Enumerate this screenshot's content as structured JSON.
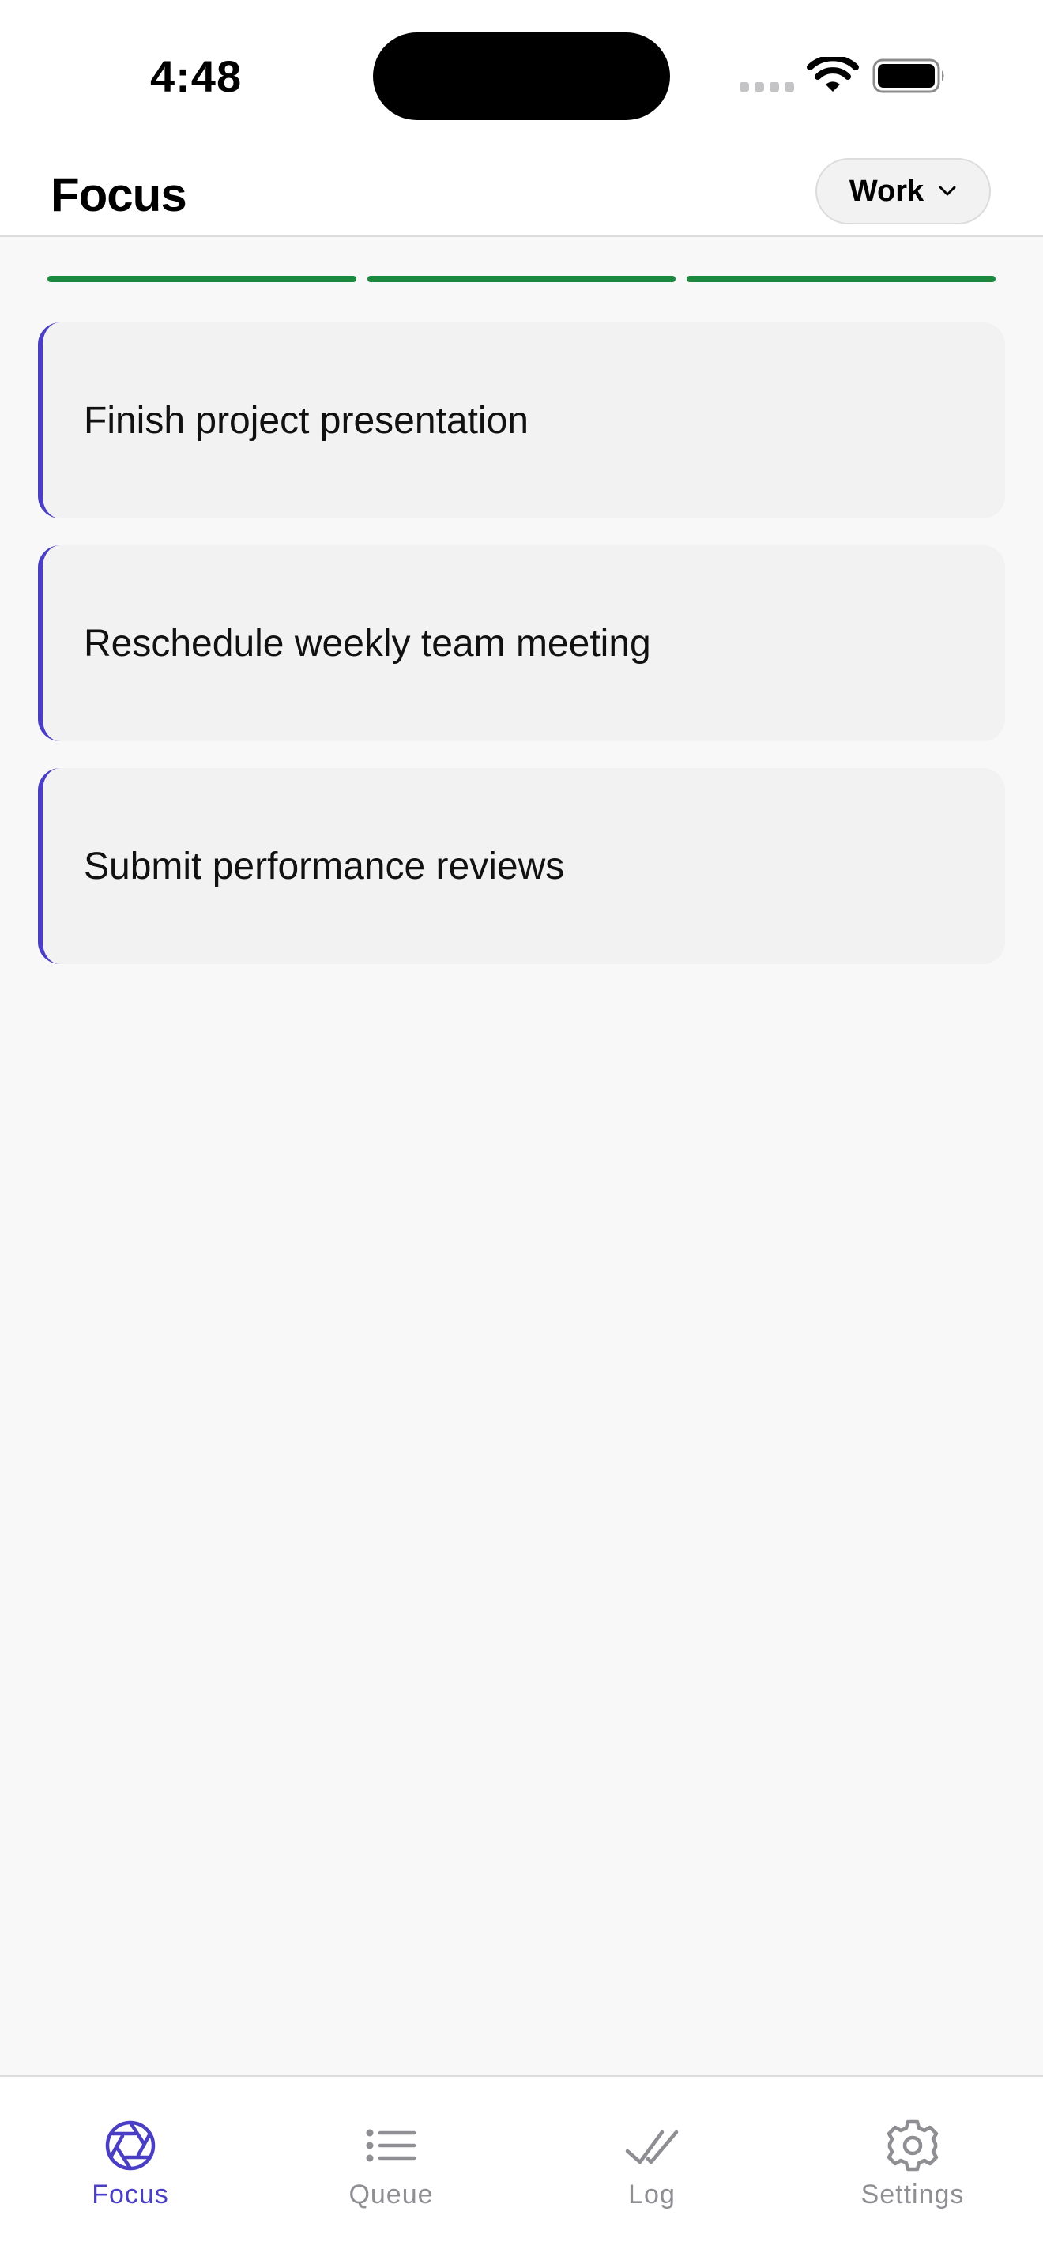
{
  "status_bar": {
    "time": "4:48"
  },
  "header": {
    "title": "Focus",
    "context_selector": {
      "selected": "Work",
      "icon": "chevron-down-icon"
    }
  },
  "progress": {
    "segments_total": 3,
    "segments_complete": 3,
    "color": "#1b8a3e"
  },
  "tasks": [
    {
      "title": "Finish project presentation"
    },
    {
      "title": "Reschedule weekly team meeting"
    },
    {
      "title": "Submit performance reviews"
    }
  ],
  "tab_bar": {
    "active": "Focus",
    "accent_color": "#4a3fc4",
    "inactive_color": "#8e8e93",
    "tabs": [
      {
        "label": "Focus",
        "icon": "aperture-icon"
      },
      {
        "label": "Queue",
        "icon": "list-icon"
      },
      {
        "label": "Log",
        "icon": "double-check-icon"
      },
      {
        "label": "Settings",
        "icon": "gear-icon"
      }
    ]
  }
}
